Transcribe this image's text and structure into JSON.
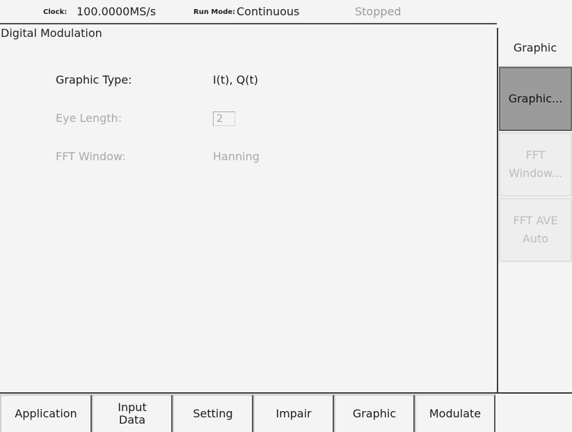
{
  "status": {
    "clock_label": "Clock:",
    "clock_value": "100.0000MS/s",
    "run_mode_label": "Run Mode:",
    "run_mode_value": "Continuous",
    "state": "Stopped"
  },
  "main": {
    "title": "Digital Modulation",
    "fields": [
      {
        "label": "Graphic Type:",
        "value": "I(t), Q(t)",
        "enabled": true
      },
      {
        "label": "Eye Length:",
        "value": "2",
        "enabled": false
      },
      {
        "label": "FFT Window:",
        "value": "Hanning",
        "enabled": false
      }
    ]
  },
  "side_menu": {
    "title": "Graphic",
    "buttons": [
      {
        "line1": "Graphic...",
        "line2": "",
        "state": "pressed"
      },
      {
        "line1": "FFT",
        "line2": "Window...",
        "state": "disabled"
      },
      {
        "line1": "FFT AVE",
        "line2": "Auto",
        "state": "disabled"
      }
    ]
  },
  "bottom_tabs": [
    {
      "line1": "Application",
      "line2": ""
    },
    {
      "line1": "Input",
      "line2": "Data"
    },
    {
      "line1": "Setting",
      "line2": ""
    },
    {
      "line1": "Impair",
      "line2": ""
    },
    {
      "line1": "Graphic",
      "line2": ""
    },
    {
      "line1": "Modulate",
      "line2": ""
    }
  ],
  "selected_tab": "Graphic"
}
